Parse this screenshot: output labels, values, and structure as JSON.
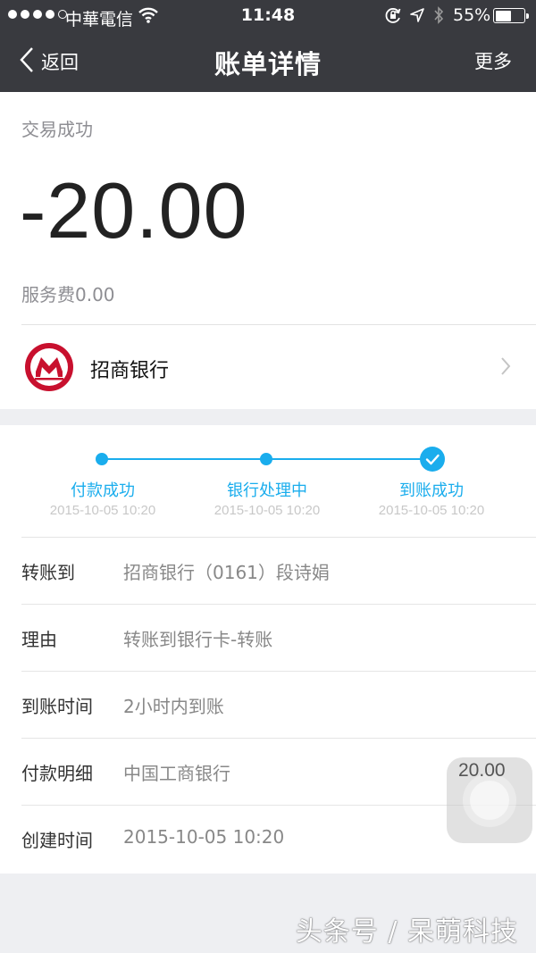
{
  "status_bar": {
    "carrier": "中華電信",
    "time": "11:48",
    "battery_pct": "55%",
    "battery_level": 0.55,
    "icons": [
      "signal-dots",
      "wifi-icon",
      "rotation-lock-icon",
      "location-arrow-icon",
      "bluetooth-icon",
      "battery-icon"
    ]
  },
  "nav": {
    "back_label": "返回",
    "title": "账单详情",
    "more_label": "更多"
  },
  "summary": {
    "status": "交易成功",
    "amount": "-20.00",
    "fee": "服务费0.00",
    "bank_name": "招商银行",
    "bank_logo": "cmb-logo"
  },
  "progress": {
    "steps": [
      {
        "label": "付款成功",
        "time": "2015-10-05 10:20"
      },
      {
        "label": "银行处理中",
        "time": "2015-10-05 10:20"
      },
      {
        "label": "到账成功",
        "time": "2015-10-05 10:20"
      }
    ],
    "accent": "#1aaded"
  },
  "details": {
    "rows": [
      {
        "label": "转账到",
        "value": "招商银行（0161）段诗娟"
      },
      {
        "label": "理由",
        "value": "转账到银行卡-转账"
      },
      {
        "label": "到账时间",
        "value": "2小时内到账"
      },
      {
        "label": "付款明细",
        "value": "中国工商银行",
        "amount": "20.00"
      },
      {
        "label": "创建时间",
        "value": "2015-10-05 10:20"
      }
    ]
  },
  "watermark": "头条号 / 呆萌科技",
  "colors": {
    "header_bg": "#393a3f",
    "page_bg": "#eeeff2",
    "accent": "#1aaded",
    "bank_red": "#c8102e"
  }
}
